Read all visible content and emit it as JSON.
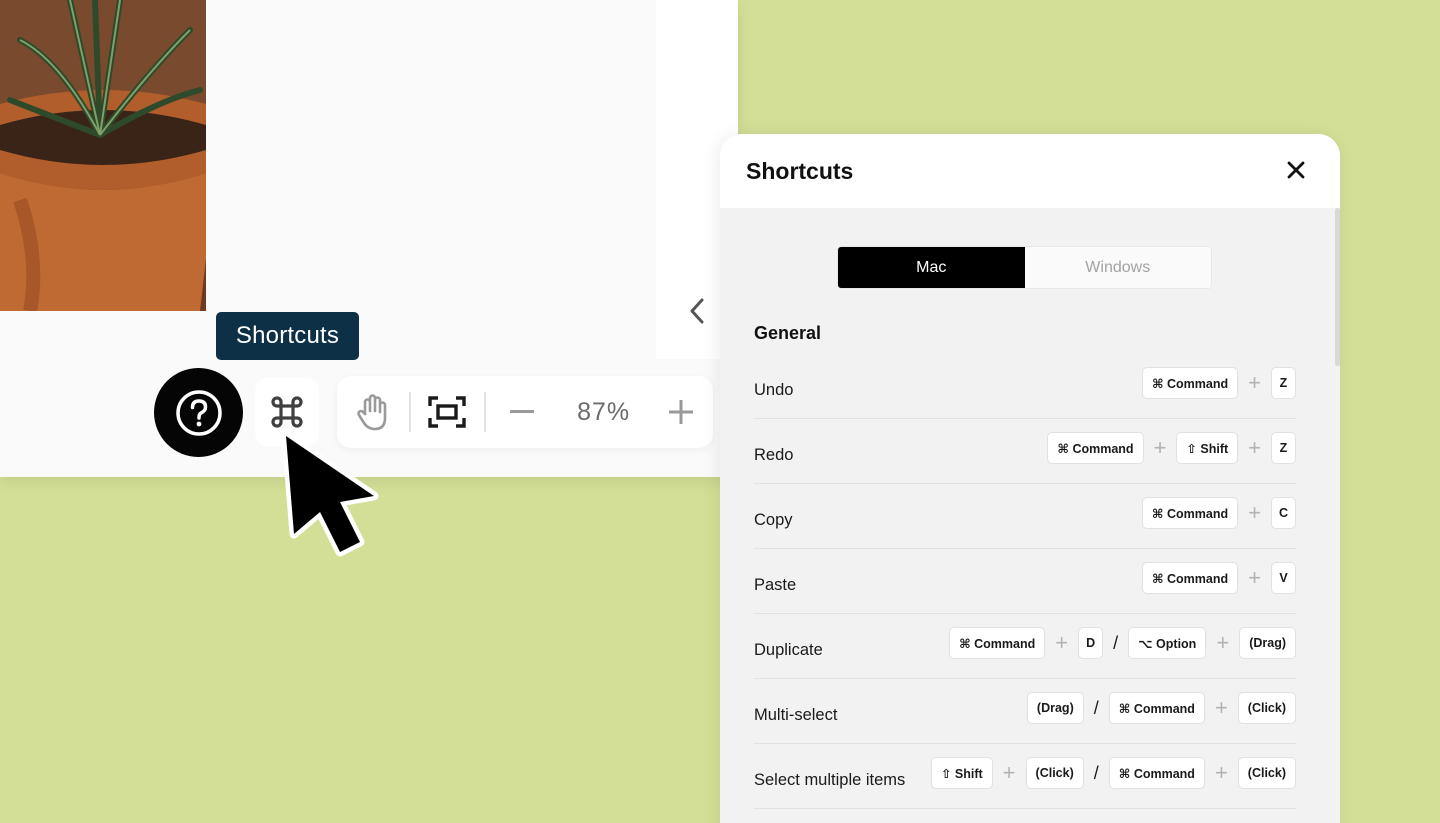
{
  "tooltip": {
    "label": "Shortcuts"
  },
  "toolbar": {
    "zoom": "87%"
  },
  "panel": {
    "title": "Shortcuts",
    "os_tabs": [
      {
        "label": "Mac",
        "active": true
      },
      {
        "label": "Windows",
        "active": false
      }
    ],
    "section": "General",
    "shortcuts": [
      {
        "name": "Undo",
        "keys": [
          {
            "t": "key",
            "label": "⌘ Command"
          },
          {
            "t": "plus"
          },
          {
            "t": "key1",
            "label": "Z"
          }
        ]
      },
      {
        "name": "Redo",
        "keys": [
          {
            "t": "key",
            "label": "⌘ Command"
          },
          {
            "t": "plus"
          },
          {
            "t": "key",
            "label": "⇧ Shift"
          },
          {
            "t": "plus"
          },
          {
            "t": "key1",
            "label": "Z"
          }
        ]
      },
      {
        "name": "Copy",
        "keys": [
          {
            "t": "key",
            "label": "⌘ Command"
          },
          {
            "t": "plus"
          },
          {
            "t": "key1",
            "label": "C"
          }
        ]
      },
      {
        "name": "Paste",
        "keys": [
          {
            "t": "key",
            "label": "⌘ Command"
          },
          {
            "t": "plus"
          },
          {
            "t": "key1",
            "label": "V"
          }
        ]
      },
      {
        "name": "Duplicate",
        "keys": [
          {
            "t": "key",
            "label": "⌘ Command"
          },
          {
            "t": "plus"
          },
          {
            "t": "key1",
            "label": "D"
          },
          {
            "t": "slash"
          },
          {
            "t": "key",
            "label": "⌥ Option"
          },
          {
            "t": "plus"
          },
          {
            "t": "key",
            "label": "(Drag)"
          }
        ]
      },
      {
        "name": "Multi-select",
        "keys": [
          {
            "t": "key",
            "label": "(Drag)"
          },
          {
            "t": "slash"
          },
          {
            "t": "key",
            "label": "⌘ Command"
          },
          {
            "t": "plus"
          },
          {
            "t": "key",
            "label": "(Click)"
          }
        ]
      },
      {
        "name": "Select multiple items",
        "keys": [
          {
            "t": "key",
            "label": "⇧ Shift"
          },
          {
            "t": "plus"
          },
          {
            "t": "key",
            "label": "(Click)"
          },
          {
            "t": "slash"
          },
          {
            "t": "key",
            "label": "⌘ Command"
          },
          {
            "t": "plus"
          },
          {
            "t": "key",
            "label": "(Click)"
          }
        ]
      }
    ]
  },
  "icons": {
    "help": "question-circle-icon",
    "command": "command-icon",
    "hand": "hand-icon",
    "fit": "fit-screen-icon",
    "minus": "minus-icon",
    "plus": "plus-icon",
    "close": "close-icon",
    "chevron": "chevron-left-icon"
  }
}
